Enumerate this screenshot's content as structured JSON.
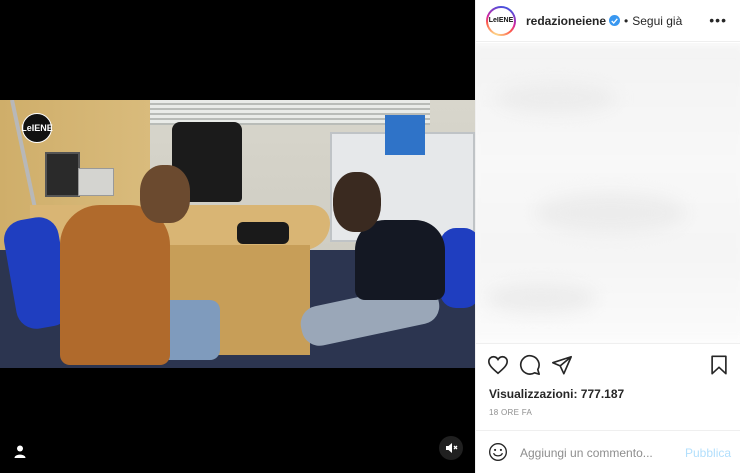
{
  "video": {
    "watermark_logo": "LeIENE",
    "user_icon": "user-icon",
    "mute_icon": "speaker-muted-icon"
  },
  "header": {
    "avatar_text": "LeIENE",
    "username": "redazioneiene",
    "verified_icon": "verified-badge-icon",
    "separator": "•",
    "follow_state": "Segui già",
    "more_icon": "more-options-icon",
    "more_glyph": "•••"
  },
  "actions": {
    "like_icon": "heart-icon",
    "comment_icon": "comment-icon",
    "share_icon": "share-icon",
    "save_icon": "bookmark-icon"
  },
  "stats": {
    "views_label": "Visualizzazioni: 777.187",
    "time_ago": "18 ORE FA"
  },
  "comment_box": {
    "emoji_icon": "emoji-icon",
    "placeholder": "Aggiungi un commento...",
    "publish_label": "Pubblica"
  },
  "colors": {
    "verified": "#3897f0",
    "publish_disabled": "#b2dffc",
    "muted_text": "#8e8e8e"
  }
}
